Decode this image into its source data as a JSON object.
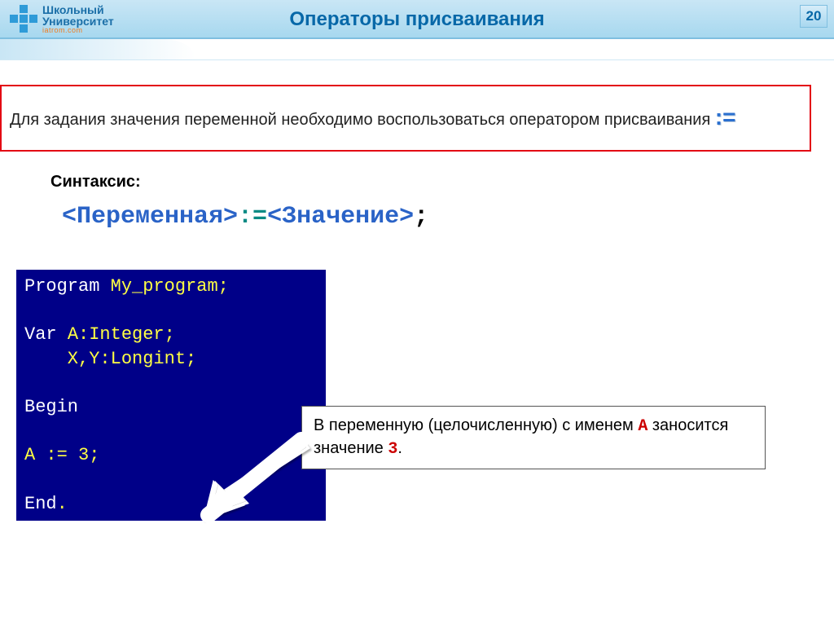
{
  "header": {
    "logo_line1": "Школьный",
    "logo_line2": "Университет",
    "logo_sub": "iatrom.com",
    "title": "Операторы присваивания",
    "page_number": "20"
  },
  "info": {
    "text_before": "Для задания значения переменной необходимо воспользоваться оператором присваивания ",
    "operator": ":="
  },
  "syntax": {
    "label": "Синтаксис:",
    "variable": "<Переменная>",
    "assign": ":=",
    "value": "<Значение>",
    "terminator": ";"
  },
  "code": {
    "l1_kw": "Program ",
    "l1_name": "My_program;",
    "l2": "",
    "l3_kw": "Var ",
    "l3_rest": "A:Integer;",
    "l4": "    X,Y:Longint;",
    "l5": "",
    "l6": "Begin",
    "l7": "",
    "l8": "A := 3;",
    "l9": "",
    "l10_kw": "End",
    "l10_dot": "."
  },
  "annotation": {
    "t1": "В переменную (целочисленную) с именем ",
    "a": "A",
    "t2": " заносится значение ",
    "three": "3",
    "t3": "."
  }
}
